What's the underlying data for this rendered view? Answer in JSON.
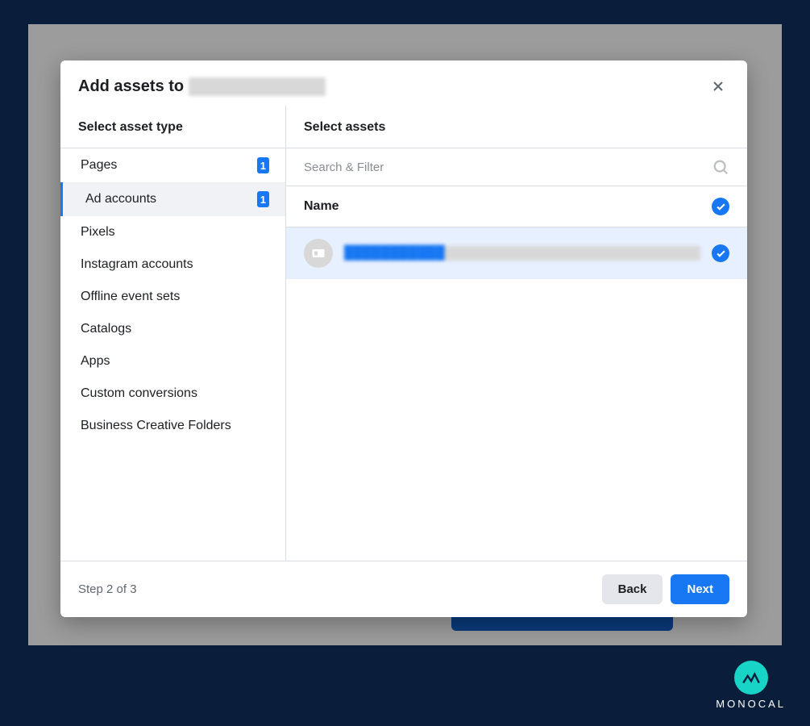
{
  "modal": {
    "title_prefix": "Add assets to",
    "title_subject_redacted": "████████████",
    "step_text": "Step 2 of 3",
    "back_label": "Back",
    "next_label": "Next"
  },
  "sidebar": {
    "title": "Select asset type",
    "items": [
      {
        "label": "Pages",
        "count": 1,
        "active": false
      },
      {
        "label": "Ad accounts",
        "count": 1,
        "active": true
      },
      {
        "label": "Pixels",
        "count": null,
        "active": false
      },
      {
        "label": "Instagram accounts",
        "count": null,
        "active": false
      },
      {
        "label": "Offline event sets",
        "count": null,
        "active": false
      },
      {
        "label": "Catalogs",
        "count": null,
        "active": false
      },
      {
        "label": "Apps",
        "count": null,
        "active": false
      },
      {
        "label": "Custom conversions",
        "count": null,
        "active": false
      },
      {
        "label": "Business Creative Folders",
        "count": null,
        "active": false
      }
    ]
  },
  "main": {
    "title": "Select assets",
    "search_placeholder": "Search & Filter",
    "column_header": "Name",
    "assets": [
      {
        "name_redacted": "███████████",
        "selected": true
      }
    ]
  },
  "brand": {
    "name": "MONOCAL"
  }
}
